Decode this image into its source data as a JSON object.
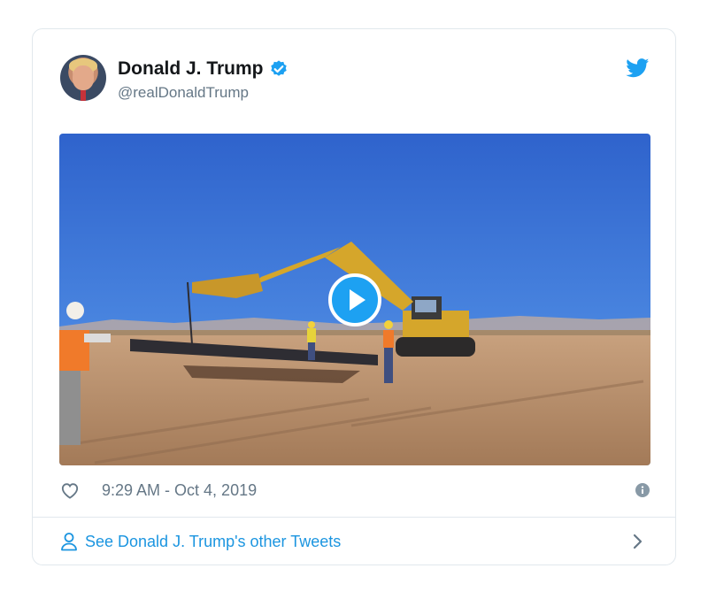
{
  "tweet": {
    "author": {
      "display_name": "Donald J. Trump",
      "handle": "@realDonaldTrump",
      "verified": true,
      "avatar_icon": "profile-photo"
    },
    "brand_icon": "twitter-bird-icon",
    "media": {
      "type": "video",
      "play_icon": "play-icon"
    },
    "like_icon": "heart-icon",
    "timestamp": "9:29 AM - Oct 4, 2019",
    "info_icon": "info-icon",
    "footer": {
      "icon": "person-icon",
      "label": "See Donald J. Trump's other Tweets",
      "chevron_icon": "chevron-right-icon"
    }
  },
  "colors": {
    "twitter_blue": "#1da1f2",
    "link_blue": "#1b95e0",
    "text_primary": "#14171a",
    "text_secondary": "#657786",
    "border": "#e1e8ed"
  }
}
